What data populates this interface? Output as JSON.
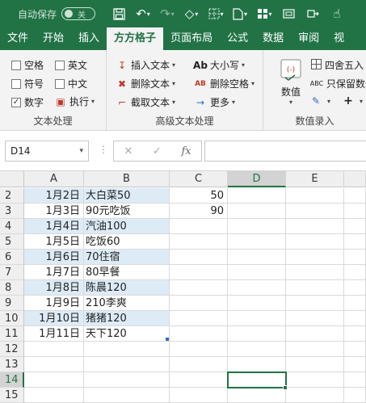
{
  "titlebar": {
    "autosave_label": "自动保存",
    "autosave_state": "关"
  },
  "tabs": [
    "文件",
    "开始",
    "插入",
    "方方格子",
    "页面布局",
    "公式",
    "数据",
    "审阅",
    "视"
  ],
  "active_tab": "方方格子",
  "ribbon": {
    "text_group": {
      "label": "文本处理",
      "checkboxes": [
        {
          "label": "空格",
          "checked": false
        },
        {
          "label": "英文",
          "checked": false
        },
        {
          "label": "符号",
          "checked": false
        },
        {
          "label": "中文",
          "checked": false
        },
        {
          "label": "数字",
          "checked": true
        }
      ],
      "execute_label": "执行"
    },
    "advanced_group": {
      "label": "高级文本处理",
      "insert_text": "插入文本",
      "delete_text": "删除文本",
      "extract_text": "截取文本",
      "case": "大小写",
      "delete_space": "删除空格",
      "more": "更多",
      "case_icon": "Ab",
      "delete_space_icon": "AB"
    },
    "value_group": {
      "label": "数值录入",
      "value_button": "数值",
      "round_label": "四舍五入",
      "keep_number_label": "只保留数值",
      "keep_number_icon": "ABC"
    }
  },
  "formula_bar": {
    "name_box": "D14",
    "fx_label": "fx",
    "value": ""
  },
  "columns": [
    "A",
    "B",
    "C",
    "D",
    "E"
  ],
  "selected_column": "D",
  "rows": [
    {
      "num": "2",
      "a": "1月2日",
      "b": "大白菜50",
      "c": "50"
    },
    {
      "num": "3",
      "a": "1月3日",
      "b": "90元吃饭",
      "c": "90"
    },
    {
      "num": "4",
      "a": "1月4日",
      "b": "汽油100",
      "c": ""
    },
    {
      "num": "5",
      "a": "1月5日",
      "b": "吃饭60",
      "c": ""
    },
    {
      "num": "6",
      "a": "1月6日",
      "b": "70住宿",
      "c": ""
    },
    {
      "num": "7",
      "a": "1月7日",
      "b": "80早餐",
      "c": ""
    },
    {
      "num": "8",
      "a": "1月8日",
      "b": "陈晨120",
      "c": ""
    },
    {
      "num": "9",
      "a": "1月9日",
      "b": "210李爽",
      "c": ""
    },
    {
      "num": "10",
      "a": "1月10日",
      "b": "猪猪120",
      "c": ""
    },
    {
      "num": "11",
      "a": "1月11日",
      "b": "天下120",
      "c": ""
    },
    {
      "num": "12",
      "a": "",
      "b": "",
      "c": ""
    },
    {
      "num": "13",
      "a": "",
      "b": "",
      "c": ""
    },
    {
      "num": "14",
      "a": "",
      "b": "",
      "c": ""
    },
    {
      "num": "15",
      "a": "",
      "b": "",
      "c": ""
    }
  ],
  "selected_row": "14",
  "colors": {
    "excel_green": "#217346",
    "band_blue": "#ddebf7"
  }
}
